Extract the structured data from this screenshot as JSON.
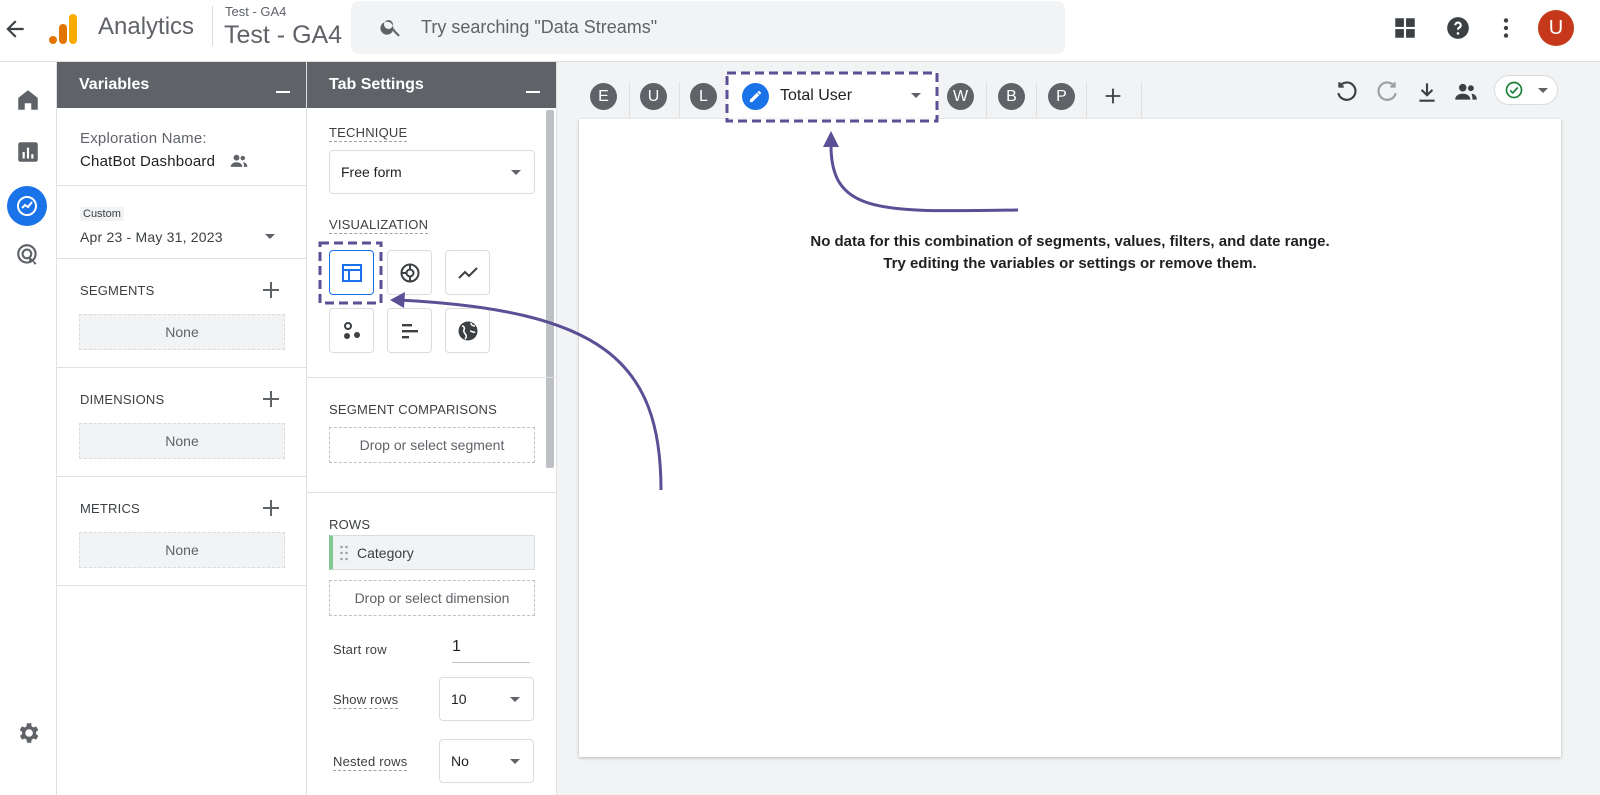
{
  "app": {
    "brand": "Analytics",
    "account_small": "Test - GA4",
    "account_big": "Test - GA4",
    "search_placeholder": "Try searching \"Data Streams\"",
    "avatar_letter": "U"
  },
  "variables": {
    "title": "Variables",
    "exploration_label": "Exploration Name:",
    "exploration_name": "ChatBot Dashboard",
    "date_tag": "Custom",
    "date_range": "Apr 23 - May 31, 2023",
    "segments": {
      "label": "SEGMENTS",
      "value": "None"
    },
    "dimensions": {
      "label": "DIMENSIONS",
      "value": "None"
    },
    "metrics": {
      "label": "METRICS",
      "value": "None"
    }
  },
  "tab_settings": {
    "title": "Tab Settings",
    "technique_label": "TECHNIQUE",
    "technique_value": "Free form",
    "visualization_label": "VISUALIZATION",
    "visualizations": [
      "table-icon",
      "donut-chart-icon",
      "line-chart-icon",
      "scatter-plot-icon",
      "bar-chart-icon",
      "geo-map-icon"
    ],
    "segment_comparisons_label": "SEGMENT COMPARISONS",
    "segment_drop": "Drop or select segment",
    "rows_label": "ROWS",
    "row_item": "Category",
    "dimension_drop": "Drop or select dimension",
    "start_row_label": "Start row",
    "start_row_value": "1",
    "show_rows_label": "Show rows",
    "show_rows_value": "10",
    "nested_rows_label": "Nested rows",
    "nested_rows_value": "No"
  },
  "tabs": {
    "letters": [
      "E",
      "U",
      "L",
      "W",
      "B",
      "P"
    ],
    "active_label": "Total User"
  },
  "canvas": {
    "message_line1": "No data for this combination of segments, values, filters, and date range.",
    "message_line2": "Try editing the variables or settings or remove them."
  },
  "colors": {
    "accent": "#1a73e8",
    "annotation": "#5b4f96",
    "avatar": "#c5391a",
    "panel_header": "#5f6368",
    "success": "#188038"
  }
}
